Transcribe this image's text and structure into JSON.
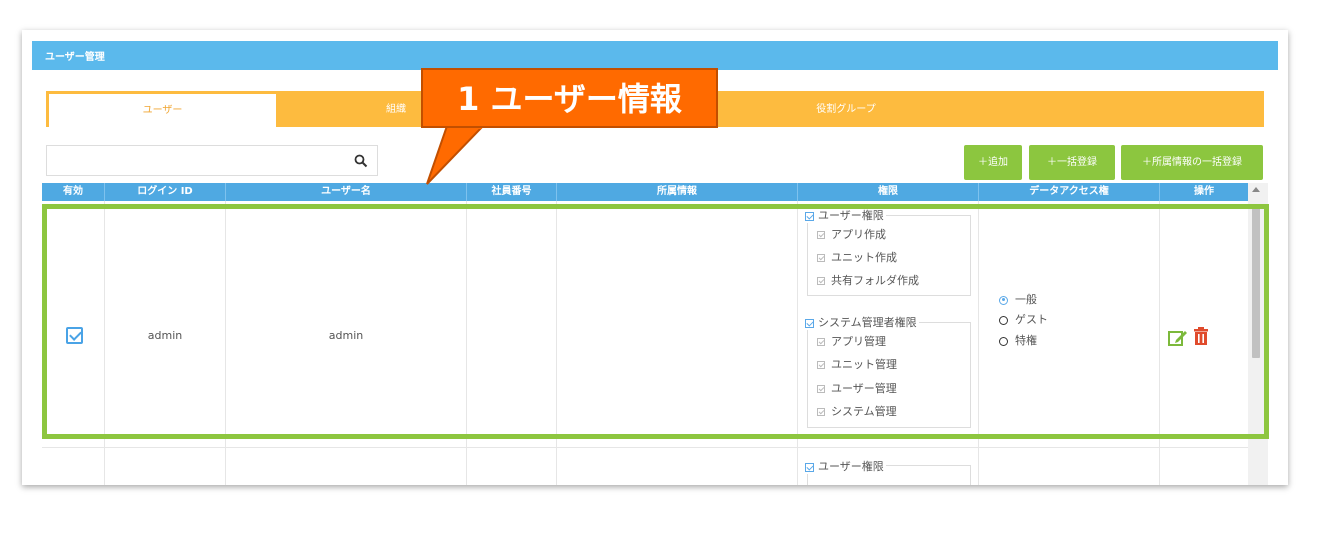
{
  "panel": {
    "title": "ユーザー管理"
  },
  "tabs": [
    {
      "label": "ユーザー",
      "active": true
    },
    {
      "label": "組織",
      "active": false
    },
    {
      "label": "役割グループ",
      "active": false
    }
  ],
  "search": {
    "placeholder": "",
    "icon": "search-icon"
  },
  "toolbar": {
    "add_label": "＋追加",
    "bulk_label": "＋一括登録",
    "bulk_affiliation_label": "＋所属情報の一括登録"
  },
  "table": {
    "headers": [
      "有効",
      "ログイン ID",
      "ユーザー名",
      "社員番号",
      "所属情報",
      "権限",
      "データアクセス権",
      "操作"
    ],
    "rows": [
      {
        "enabled": true,
        "login_id": "admin",
        "user_name": "admin",
        "employee_no": "",
        "affiliation": "",
        "permissions": {
          "user_group_label": "ユーザー権限",
          "user_items": [
            "アプリ作成",
            "ユニット作成",
            "共有フォルダ作成"
          ],
          "admin_group_label": "システム管理者権限",
          "admin_items": [
            "アプリ管理",
            "ユニット管理",
            "ユーザー管理",
            "システム管理"
          ]
        },
        "data_access": {
          "options": [
            "一般",
            "ゲスト",
            "特権"
          ],
          "selected": "一般"
        }
      },
      {
        "permissions": {
          "user_group_label": "ユーザー権限"
        }
      }
    ]
  },
  "annotation": {
    "label": "1 ユーザー情報",
    "color": "#ff6a00",
    "highlight_color": "#8dc63f"
  }
}
